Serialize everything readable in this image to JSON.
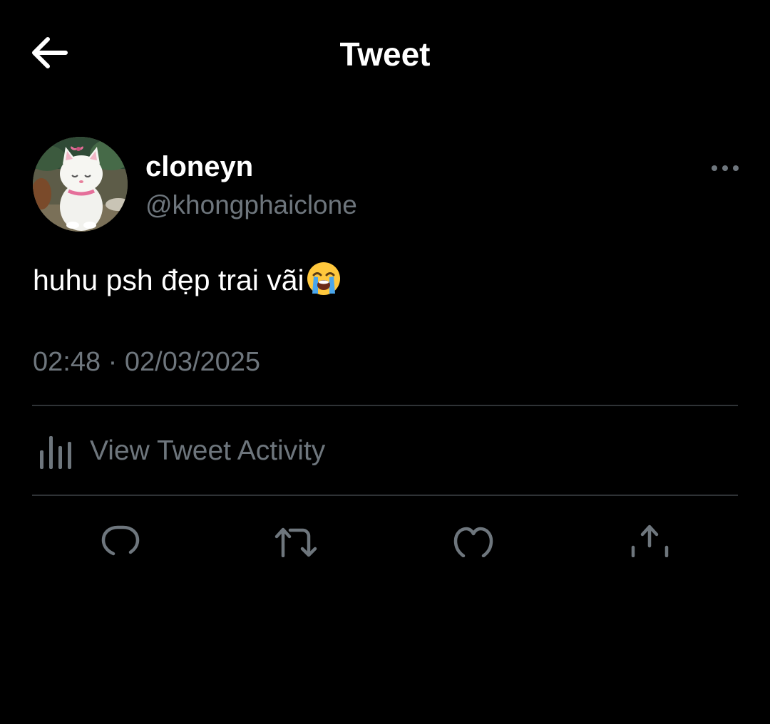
{
  "header": {
    "title": "Tweet",
    "back_icon": "arrow-left-icon"
  },
  "tweet": {
    "author": {
      "display_name": "cloneyn",
      "handle": "@khongphaiclone",
      "avatar": "white-cat-avatar"
    },
    "more_icon": "more-horizontal-icon",
    "text": "huhu psh đẹp trai vãi",
    "emoji": "loudly-crying-face-emoji",
    "timestamp": "02:48 · 02/03/2025",
    "activity_label": "View Tweet Activity",
    "activity_icon": "bar-chart-icon"
  },
  "actions": [
    {
      "icon": "reply-icon"
    },
    {
      "icon": "retweet-icon"
    },
    {
      "icon": "like-icon"
    },
    {
      "icon": "share-icon"
    }
  ],
  "colors": {
    "background": "#000000",
    "primary_text": "#ffffff",
    "secondary_text": "#6e767d",
    "divider": "#2f3336"
  }
}
